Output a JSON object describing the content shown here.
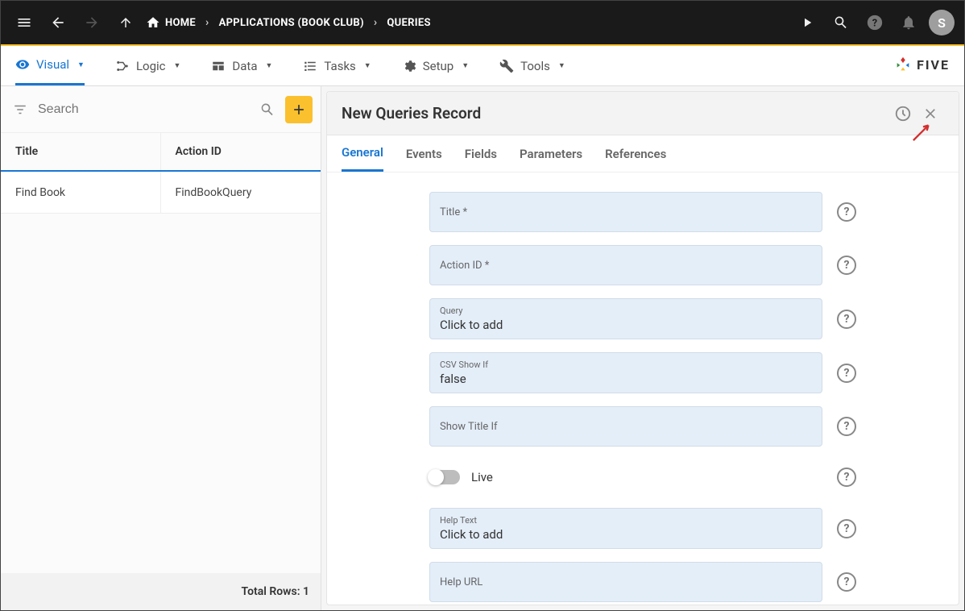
{
  "topbar": {
    "home_label": "HOME",
    "crumbs": [
      "APPLICATIONS (BOOK CLUB)",
      "QUERIES"
    ],
    "avatar_initial": "S"
  },
  "navtabs": {
    "items": [
      {
        "label": "Visual",
        "active": true
      },
      {
        "label": "Logic"
      },
      {
        "label": "Data"
      },
      {
        "label": "Tasks"
      },
      {
        "label": "Setup"
      },
      {
        "label": "Tools"
      }
    ],
    "logo_text": "FIVE"
  },
  "leftpanel": {
    "search_placeholder": "Search",
    "columns": {
      "title": "Title",
      "action_id": "Action ID"
    },
    "rows": [
      {
        "title": "Find Book",
        "action_id": "FindBookQuery"
      }
    ],
    "footer": "Total Rows: 1"
  },
  "rightpanel": {
    "header_title": "New Queries Record",
    "subtabs": [
      "General",
      "Events",
      "Fields",
      "Parameters",
      "References"
    ],
    "active_subtab": "General",
    "fields": {
      "title": {
        "label": "Title *",
        "value": ""
      },
      "action_id": {
        "label": "Action ID *",
        "value": ""
      },
      "query": {
        "label": "Query",
        "value": "Click to add"
      },
      "csv_show_if": {
        "label": "CSV Show If",
        "value": "false"
      },
      "show_title_if": {
        "label": "Show Title If",
        "value": ""
      },
      "live": {
        "label": "Live",
        "on": false
      },
      "help_text": {
        "label": "Help Text",
        "value": "Click to add"
      },
      "help_url": {
        "label": "Help URL",
        "value": ""
      }
    }
  }
}
